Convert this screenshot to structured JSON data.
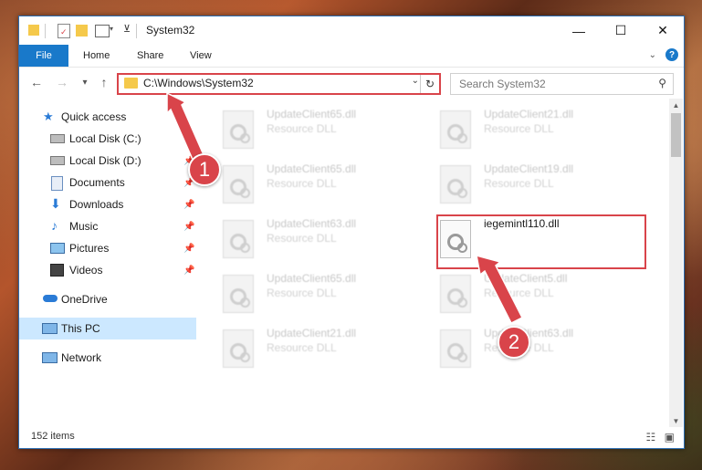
{
  "window": {
    "title": "System32",
    "minimize": "—",
    "maximize": "☐",
    "close": "✕"
  },
  "ribbon": {
    "file": "File",
    "tabs": [
      "Home",
      "Share",
      "View"
    ],
    "help": "?"
  },
  "nav": {
    "back": "←",
    "forward": "→",
    "recent": "▾",
    "up": "↑",
    "address": "C:\\Windows\\System32",
    "search_placeholder": "Search System32"
  },
  "sidebar": {
    "items": [
      {
        "label": "Quick access",
        "icon": "star-icon"
      },
      {
        "label": "Local Disk (C:)",
        "icon": "drive-icon",
        "pinned": true
      },
      {
        "label": "Local Disk (D:)",
        "icon": "drive-icon",
        "pinned": true
      },
      {
        "label": "Documents",
        "icon": "documents-icon",
        "pinned": true
      },
      {
        "label": "Downloads",
        "icon": "downloads-icon",
        "pinned": true
      },
      {
        "label": "Music",
        "icon": "music-icon",
        "pinned": true
      },
      {
        "label": "Pictures",
        "icon": "pictures-icon",
        "pinned": true
      },
      {
        "label": "Videos",
        "icon": "videos-icon",
        "pinned": true
      },
      {
        "label": "OneDrive",
        "icon": "onedrive-icon"
      },
      {
        "label": "This PC",
        "icon": "computer-icon",
        "selected": true
      },
      {
        "label": "Network",
        "icon": "network-icon"
      }
    ]
  },
  "files": [
    {
      "name": "UpdateClient65.dll",
      "type": "Resource DLL"
    },
    {
      "name": "UpdateClient21.dll",
      "type": "Resource DLL"
    },
    {
      "name": "UpdateClient65.dll",
      "type": "Resource DLL"
    },
    {
      "name": "UpdateClient19.dll",
      "type": "Resource DLL"
    },
    {
      "name": "UpdateClient63.dll",
      "type": "Resource DLL"
    },
    {
      "name": "iegemintl110.dll",
      "type": ""
    },
    {
      "name": "UpdateClient65.dll",
      "type": "Resource DLL"
    },
    {
      "name": "UpdateClient5.dll",
      "type": "Resource DLL"
    },
    {
      "name": "UpdateClient21.dll",
      "type": "Resource DLL"
    },
    {
      "name": "UpdateClient63.dll",
      "type": "Resource DLL"
    }
  ],
  "status": {
    "item_count": "152 items"
  },
  "annotations": {
    "step1": "1",
    "step2": "2",
    "color": "#d9444a"
  }
}
